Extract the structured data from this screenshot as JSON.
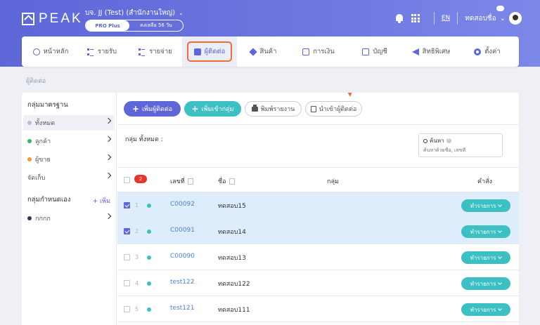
{
  "brand": {
    "logo_text": "PEAK",
    "accent": "#5d67d8",
    "teal": "#3cc0c4",
    "highlight": "#f16a3a"
  },
  "company": {
    "name": "บจ. JJ (Test) (สำนักงานใหญ่)",
    "plan_label": "PRO Plus",
    "days_left": "คงเหลือ 56 วัน"
  },
  "header": {
    "lang": "EN",
    "user_name": "ทดสอบชื่อ"
  },
  "nav": {
    "items": [
      {
        "label": "หน้าหลัก",
        "icon": "home-icon"
      },
      {
        "label": "รายรับ",
        "icon": "income-icon"
      },
      {
        "label": "รายจ่าย",
        "icon": "expense-icon"
      },
      {
        "label": "ผู้ติดต่อ",
        "icon": "contact-card-icon",
        "active": true
      },
      {
        "label": "สินค้า",
        "icon": "box-icon"
      },
      {
        "label": "การเงิน",
        "icon": "money-icon"
      },
      {
        "label": "บัญชี",
        "icon": "book-icon"
      },
      {
        "label": "สิทธิพิเศษ",
        "icon": "megaphone-icon"
      },
      {
        "label": "ตั้งค่า",
        "icon": "gear-icon"
      }
    ]
  },
  "breadcrumb": "ผู้ติดต่อ",
  "sidebar": {
    "standard_title": "กลุ่มมาตรฐาน",
    "items": [
      {
        "label": "ทั้งหมด",
        "dot": "#b8bcc6"
      },
      {
        "label": "ลูกค้า",
        "dot": "#34b36b"
      },
      {
        "label": "ผู้ขาย",
        "dot": "#f5923e"
      },
      {
        "label": "จัดเก็บ",
        "dot": ""
      }
    ],
    "custom_title": "กลุ่มกำหนดเอง",
    "add_label": "+ เพิ่ม",
    "custom_items": [
      {
        "label": "กกกก",
        "dot": "#2f3a5a"
      }
    ]
  },
  "toolbar": {
    "add_contact": "เพิ่มผู้ติดต่อ",
    "add_to_group": "เพิ่มเข้ากลุ่ม",
    "print_report": "พิมพ์รายงาน",
    "import_contacts": "นำเข้าผู้ติดต่อ"
  },
  "group_label": "กลุ่ม ทั้งหมด :",
  "search": {
    "label": "ค้นหา",
    "placeholder": "ค้นหาด้วยชื่อ, เลขที่"
  },
  "table": {
    "selected_count": "2",
    "headers": {
      "code": "เลขที่",
      "name": "ชื่อ",
      "group": "กลุ่ม",
      "action": "คำสั่ง"
    },
    "action_label": "ทำรายการ",
    "rows": [
      {
        "num": "1",
        "code": "C00092",
        "name": "ทดสอบ15",
        "checked": true
      },
      {
        "num": "2",
        "code": "C00091",
        "name": "ทดสอบ14",
        "checked": true
      },
      {
        "num": "3",
        "code": "C00090",
        "name": "ทดสอบ13",
        "checked": false
      },
      {
        "num": "4",
        "code": "test122",
        "name": "ทดสอบ122",
        "checked": false
      },
      {
        "num": "5",
        "code": "test121",
        "name": "ทดสอบ111",
        "checked": false
      }
    ]
  }
}
